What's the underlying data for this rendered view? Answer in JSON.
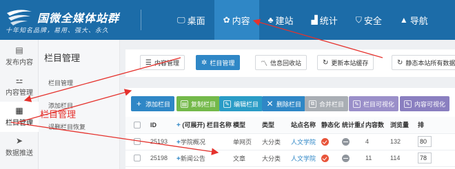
{
  "header": {
    "logo_title": "国微全媒体站群",
    "logo_subtitle": "十年知名品牌，易用、强大、永久",
    "nav": [
      {
        "icon": "monitor-icon",
        "label": "桌面"
      },
      {
        "icon": "refresh-icon",
        "label": "内容"
      },
      {
        "icon": "tree-icon",
        "label": "建站"
      },
      {
        "icon": "bar-chart-icon",
        "label": "统计"
      },
      {
        "icon": "shield-icon",
        "label": "安全"
      },
      {
        "icon": "navigation-icon",
        "label": "导航"
      }
    ],
    "active_nav": "内容"
  },
  "sidebar": {
    "items": [
      {
        "icon": "publish-icon",
        "label": "发布内容"
      },
      {
        "icon": "content-manage-icon",
        "label": "内容管理"
      },
      {
        "icon": "grid-icon",
        "label": "栏目管理"
      },
      {
        "icon": "send-icon",
        "label": "数据推送"
      }
    ],
    "active": "栏目管理"
  },
  "subnav": {
    "title": "栏目管理",
    "items": [
      "栏目管理",
      "添加栏目",
      "误删栏目恢复"
    ],
    "overlay_label": "栏目管理"
  },
  "toolbar": {
    "buttons": [
      "内容管理",
      "栏目管理",
      "信息回收站",
      "更新本站缓存",
      "静态本站所有数据"
    ]
  },
  "actions": {
    "buttons": [
      {
        "label": "添加栏目",
        "color": "#2f87c6"
      },
      {
        "label": "复制栏目",
        "color": "#74b94a"
      },
      {
        "label": "编辑栏目",
        "color": "#2a9cc6"
      },
      {
        "label": "删除栏目",
        "color": "#2f87c6"
      },
      {
        "label": "合并栏目",
        "color": "#a9aeb4"
      },
      {
        "label": "栏目可视化",
        "color": "#9a8fc9"
      },
      {
        "label": "内容可视化",
        "color": "#8a7fc0"
      }
    ]
  },
  "table": {
    "columns": [
      "ID",
      "(可展开) 栏目名称",
      "模型",
      "类型",
      "站点名称",
      "静态化",
      "统计重点",
      "内容数",
      "浏览量",
      "排"
    ],
    "rows": [
      {
        "id": "25193",
        "name": "学院概况",
        "model": "单网页",
        "type": "大分类",
        "site": "人文学院",
        "static": true,
        "stat": false,
        "count": "4",
        "views": "132",
        "sort": "80"
      },
      {
        "id": "25198",
        "name": "新闻公告",
        "model": "文章",
        "type": "大分类",
        "site": "人文学院",
        "static": true,
        "stat": false,
        "count": "11",
        "views": "114",
        "sort": "78"
      }
    ]
  },
  "colors": {
    "header": "#1c6ca8",
    "accent": "#2f87c6",
    "annotation": "#e5322d"
  }
}
